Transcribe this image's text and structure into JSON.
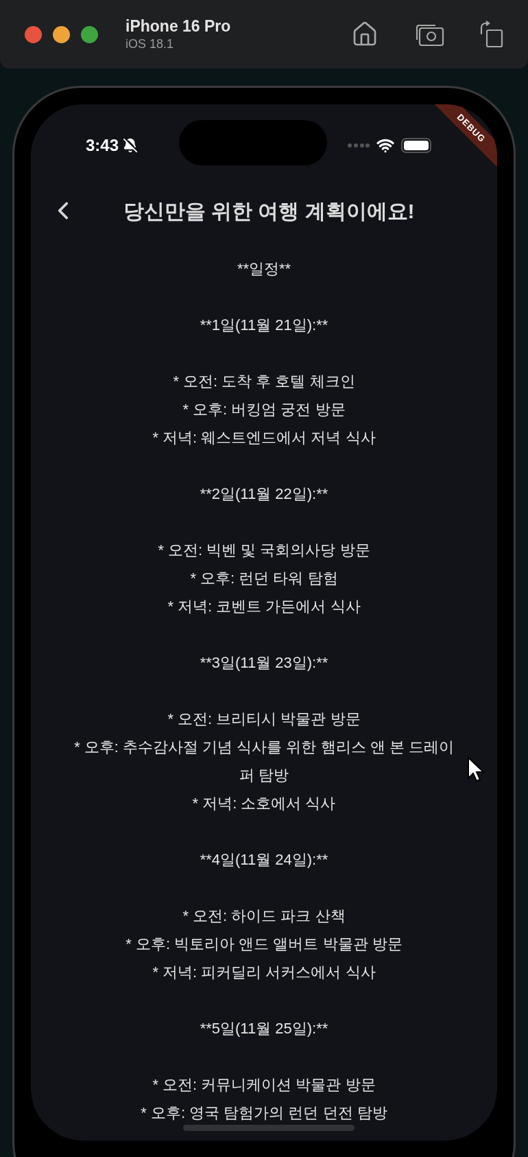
{
  "window": {
    "title": "iPhone 16 Pro",
    "subtitle": "iOS 18.1"
  },
  "status_bar": {
    "time": "3:43"
  },
  "debug_banner": "DEBUG",
  "nav": {
    "title": "당신만을 위한 여행 계획이에요!"
  },
  "plan": {
    "heading": "**일정**",
    "days": [
      {
        "heading": "**1일(11월 21일):**",
        "items": [
          "* 오전: 도착 후 호텔 체크인",
          "* 오후: 버킹엄 궁전 방문",
          "* 저녁: 웨스트엔드에서 저녁 식사"
        ]
      },
      {
        "heading": "**2일(11월 22일):**",
        "items": [
          "* 오전: 빅벤 및 국회의사당 방문",
          "* 오후: 런던 타워 탐험",
          "* 저녁: 코벤트 가든에서 식사"
        ]
      },
      {
        "heading": "**3일(11월 23일):**",
        "items": [
          "* 오전: 브리티시 박물관 방문",
          "* 오후: 추수감사절 기념 식사를 위한 햄리스 앤 본 드레이퍼 탐방",
          "* 저녁: 소호에서 식사"
        ]
      },
      {
        "heading": "**4일(11월 24일):**",
        "items": [
          "* 오전: 하이드 파크 산책",
          "* 오후: 빅토리아 앤드 앨버트 박물관 방문",
          "* 저녁: 피커딜리 서커스에서 식사"
        ]
      },
      {
        "heading": "**5일(11월 25일):**",
        "items": [
          "* 오전: 커뮤니케이션 박물관 방문",
          "* 오후: 영국 탐험가의 런던 던전 탐방"
        ]
      }
    ]
  }
}
